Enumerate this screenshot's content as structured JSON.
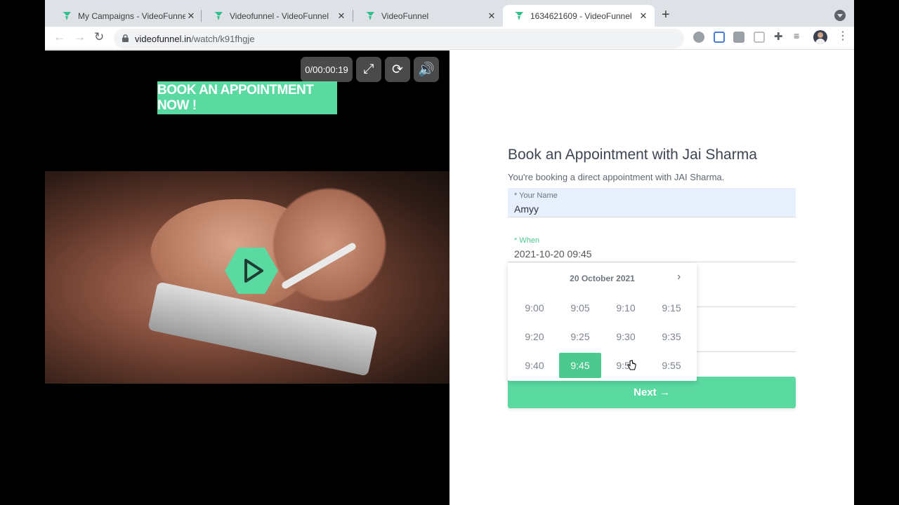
{
  "browser": {
    "tabs": [
      {
        "title": "My Campaigns - VideoFunnel",
        "active": false
      },
      {
        "title": "Videofunnel - VideoFunnel",
        "active": false
      },
      {
        "title": "VideoFunnel",
        "active": false
      },
      {
        "title": "1634621609 - VideoFunnel",
        "active": true
      }
    ],
    "url_host": "videofunnel.in",
    "url_path": "/watch/k91fhgje",
    "accent": "#4cc98f"
  },
  "video": {
    "time": "0/00:00:19",
    "cta_label": "BOOK AN APPOINTMENT NOW !",
    "icons": [
      "fullscreen-icon",
      "refresh-icon",
      "volume-icon",
      "play-icon"
    ]
  },
  "form": {
    "title": "Book an Appointment with Jai Sharma",
    "subtitle": "You're booking a direct appointment with JAI Sharma.",
    "name_label": "* Your Name",
    "name_value": "Amyy",
    "when_label": "* When",
    "when_value": "2021-10-20 09:45",
    "next_label": "Next →"
  },
  "picker": {
    "date": "20 October 2021",
    "next_icon": "›",
    "times": [
      "9:00",
      "9:05",
      "9:10",
      "9:15",
      "9:20",
      "9:25",
      "9:30",
      "9:35",
      "9:40",
      "9:45",
      "9:50",
      "9:55"
    ],
    "selected": "9:45"
  }
}
